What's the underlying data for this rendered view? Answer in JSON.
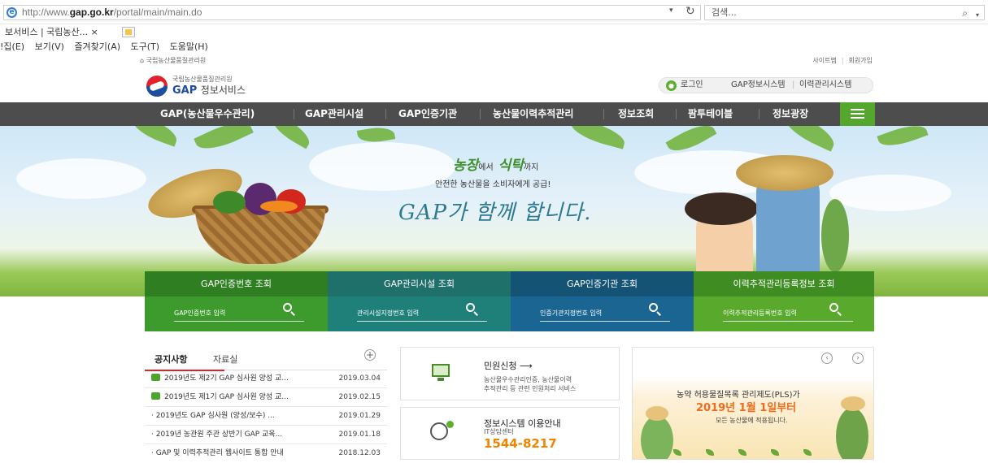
{
  "browser": {
    "url_prefix": "http://www.",
    "url_domain": "gap.go.kr",
    "url_path": "/portal/main/main.do",
    "dropdown": "▾",
    "reload": "↻",
    "search_placeholder": "검색...",
    "search_icon": "search-icon",
    "tab_title": "보서비스 | 국립농산... ×",
    "menu": [
      "!집(E)",
      "보기(V)",
      "즐겨찾기(A)",
      "도구(T)",
      "도움말(H)"
    ]
  },
  "header": {
    "home_link": "국립농산물품질관리원",
    "top_links": [
      "사이트맵",
      "회원가입"
    ],
    "logo_small": "국립농산물품질관리원",
    "logo_big": "GAP",
    "logo_big_suffix": "정보서비스",
    "login": "로그인",
    "sys_links": [
      "GAP정보시스템",
      "이력관리시스템"
    ]
  },
  "gnb": {
    "items": [
      "GAP(농산물우수관리)",
      "GAP관리시설",
      "GAP인증기관",
      "농산물이력추적관리",
      "정보조회",
      "팜투테이블",
      "정보광장"
    ],
    "menu_icon": "hamburger-icon",
    "accent": "#55a62c"
  },
  "hero": {
    "line1_a": "농장",
    "line1_b": "에서",
    "line1_c": "식탁",
    "line1_d": "까지",
    "line2": "안전한 농산물을 소비자에게 공급!",
    "line3": "GAP가 함께 합니다."
  },
  "search_boxes": [
    {
      "title": "GAP인증번호 조회",
      "placeholder": "GAP인증번호 입력",
      "title_color": "#2f7f22",
      "body_color": "#3d9a2d"
    },
    {
      "title": "GAP관리시설 조회",
      "placeholder": "관리시설지정번호 입력",
      "title_color": "#1f6f6a",
      "body_color": "#1e8079"
    },
    {
      "title": "GAP인증기관 조회",
      "placeholder": "인증기관지정번호 입력",
      "title_color": "#155375",
      "body_color": "#1b6592"
    },
    {
      "title": "이력추적관리등록정보 조회",
      "placeholder": "이력추적관리등록번호 입력",
      "title_color": "#3e8c22",
      "body_color": "#58a92c"
    }
  ],
  "notice": {
    "tab_active": "공지사항",
    "tab_inactive": "자료실",
    "more": "+",
    "rows": [
      {
        "title": "2019년도 제2기 GAP 심사원 양성 교...",
        "date": "2019.03.04",
        "new": true
      },
      {
        "title": "2019년도 제1기 GAP 심사원 양성 교...",
        "date": "2019.02.15",
        "new": true
      },
      {
        "title": "· 2019년도 GAP 심사원 (양성/보수) ...",
        "date": "2019.01.29",
        "new": false
      },
      {
        "title": "· 2019년 농관원 주관 상반기 GAP 교육...",
        "date": "2019.01.18",
        "new": false
      },
      {
        "title": "· GAP 및 이력추적관리 웹사이트 통합 안내",
        "date": "2018.12.03",
        "new": false
      }
    ]
  },
  "cards": {
    "civil_title": "민원신청 ⟶",
    "civil_desc1": "농산물우수관리인증, 농산물이력",
    "civil_desc2": "추적관리 등 관련 민원처리 서비스",
    "guide_title": "정보시스템 이용안내",
    "guide_sub": "IT상담센터",
    "guide_phone": "1544-8217"
  },
  "banner": {
    "prev": "‹",
    "next": "›",
    "line1": "농약 허용물질목록 관리제도(PLS)가",
    "line2": "2019년 1월 1일부터",
    "line3": "모든 농산물에 적용됩니다."
  }
}
